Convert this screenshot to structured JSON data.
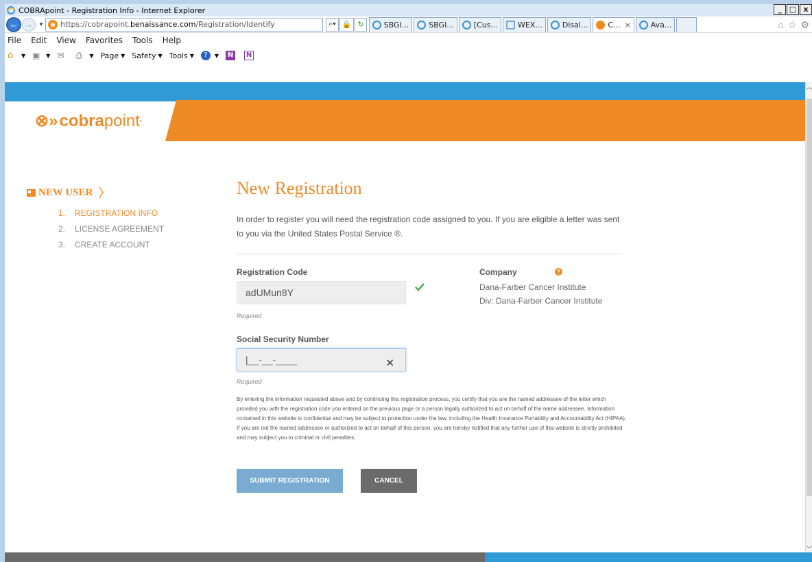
{
  "window": {
    "title": "COBRApoint - Registration Info - Internet Explorer",
    "controls": [
      "_",
      "□",
      "x"
    ]
  },
  "browser": {
    "url_prefix": "https://cobrapoint.",
    "url_domain": "benaissance.com",
    "url_path": "/Registration/Identify",
    "tabs": [
      {
        "label": "SBGI...",
        "active": false
      },
      {
        "label": "SBGI...",
        "active": false
      },
      {
        "label": "[Cus...",
        "active": false
      },
      {
        "label": "WEX...",
        "active": false
      },
      {
        "label": "Disal...",
        "active": false
      },
      {
        "label": "C...",
        "active": true
      },
      {
        "label": "Ava...",
        "active": false
      }
    ],
    "menu": [
      "File",
      "Edit",
      "View",
      "Favorites",
      "Tools",
      "Help"
    ],
    "command_bar": [
      "Page",
      "Safety",
      "Tools"
    ]
  },
  "brand": {
    "mark": "⊗»",
    "bold": "cobra",
    "light": "point",
    "accent_color": "#ef8a24",
    "bar_color": "#2f9ad5"
  },
  "sidebar": {
    "heading": "NEW USER",
    "steps": [
      {
        "num": "1.",
        "label": "REGISTRATION INFO",
        "active": true
      },
      {
        "num": "2.",
        "label": "LICENSE AGREEMENT",
        "active": false
      },
      {
        "num": "3.",
        "label": "CREATE ACCOUNT",
        "active": false
      }
    ]
  },
  "form": {
    "title": "New Registration",
    "intro": "In order to register you will need the registration code assigned to you. If you are eligible a letter was sent to you via the United States Postal Service ®.",
    "registration_code": {
      "label": "Registration Code",
      "value": "adUMun8Y",
      "hint": "Required"
    },
    "ssn": {
      "label": "Social Security Number",
      "value": "|__-__-____",
      "hint": "Required"
    },
    "company": {
      "label": "Company",
      "name": "Dana-Farber Cancer Institute",
      "division": "Div: Dana-Farber Cancer Institute"
    },
    "legal": "By entering the information requested above and by continuing this registration process, you certify that you are the named addressee of the letter which provided you with the registration code you entered on the previous page or a person legally authorized to act on behalf of the name addressee. Information contained in this website is confidential and may be subject to protection under the law, including the Health Insurance Portability and Accountability Act (HIPAA). If you are not the named addressee or authorized to act on behalf of this person, you are hereby notified that any further use of this website is strictly prohibited and may subject you to criminal or civil penalties.",
    "submit_label": "SUBMIT REGISTRATION",
    "cancel_label": "CANCEL"
  }
}
